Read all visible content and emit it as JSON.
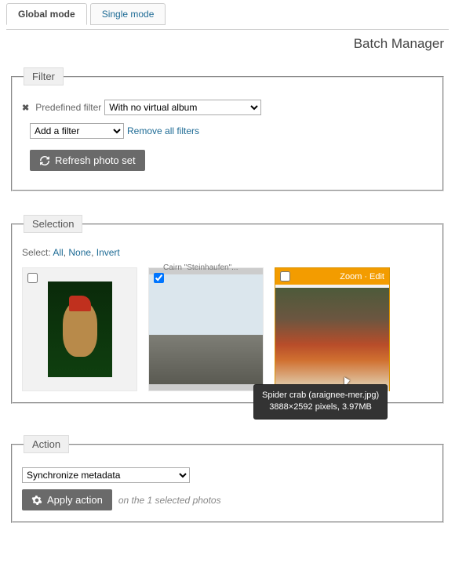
{
  "tabs": {
    "global": "Global mode",
    "single": "Single mode"
  },
  "page_title": "Batch Manager",
  "filter": {
    "legend": "Filter",
    "predefined_label": "Predefined filter",
    "predefined_value": "With no virtual album",
    "add_filter_value": "Add a filter",
    "remove_all": "Remove all filters",
    "refresh_btn": "Refresh photo set"
  },
  "selection": {
    "legend": "Selection",
    "select_label": "Select:",
    "all": "All",
    "none": "None",
    "invert": "Invert",
    "hover_zoom": "Zoom",
    "hover_edit": "Edit",
    "tooltip_line1": "Spider crab (araignee-mer.jpg)",
    "tooltip_line2": "3888×2592 pixels, 3.97MB",
    "trunc_caption": "Cairn \"Steinhaufen\"..."
  },
  "action": {
    "legend": "Action",
    "select_value": "Synchronize metadata",
    "apply_btn": "Apply action",
    "note": "on the 1 selected photos"
  }
}
